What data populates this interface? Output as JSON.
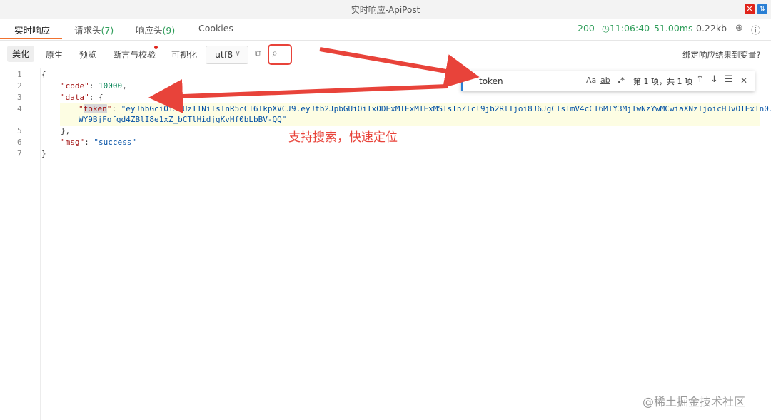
{
  "window": {
    "title": "实时响应-ApiPost",
    "close_icon": "close-icon",
    "pin_icon": "pin-icon",
    "accent_close": "#e0241b",
    "accent_pin": "#2a7fd4"
  },
  "tabs": [
    {
      "label": "实时响应",
      "count": ""
    },
    {
      "label": "请求头",
      "count": "(7)"
    },
    {
      "label": "响应头",
      "count": "(9)"
    },
    {
      "label": "Cookies",
      "count": ""
    }
  ],
  "status": {
    "code": "200",
    "time": "11:06:40",
    "duration": "51.00ms",
    "size": "0.22kb"
  },
  "view_tabs": [
    "美化",
    "原生",
    "预览",
    "断言与校验",
    "可视化"
  ],
  "encoding": "utf8",
  "bind_link": "绑定响应结果到变量?",
  "code_lines": {
    "l1": "{",
    "k_code": "\"code\"",
    "v_code": "10000",
    "k_data": "\"data\"",
    "k_token": "token",
    "v_token_1": "\"eyJhbGciOiJIUzI1NiIsInR5cCI6IkpXVCJ9.eyJtb2JpbGUiOiIxODExMTExMTExMSIsInZlcl9jb2RlIjoi8J6JgCIsImV4cCI6MTY3MjIwNzYwMCwiaXNzIjoicHJvOTExIn0.",
    "v_token_2": "WY9BjFofgd4ZBlI8e1xZ_bCTlHidjgKvHf0bLbBV-QQ\"",
    "k_msg": "\"msg\"",
    "v_msg": "\"success\""
  },
  "line_numbers": [
    "1",
    "2",
    "3",
    "4",
    "5",
    "6",
    "7"
  ],
  "find": {
    "query": "token",
    "case_label": "Aa",
    "word_label": "ab",
    "regex_label": ".*",
    "result": "第 1 项，共 1 项"
  },
  "annotation": "支持搜索，快速定位",
  "watermark": "@稀土掘金技术社区",
  "annotation_color": "#e8433a"
}
